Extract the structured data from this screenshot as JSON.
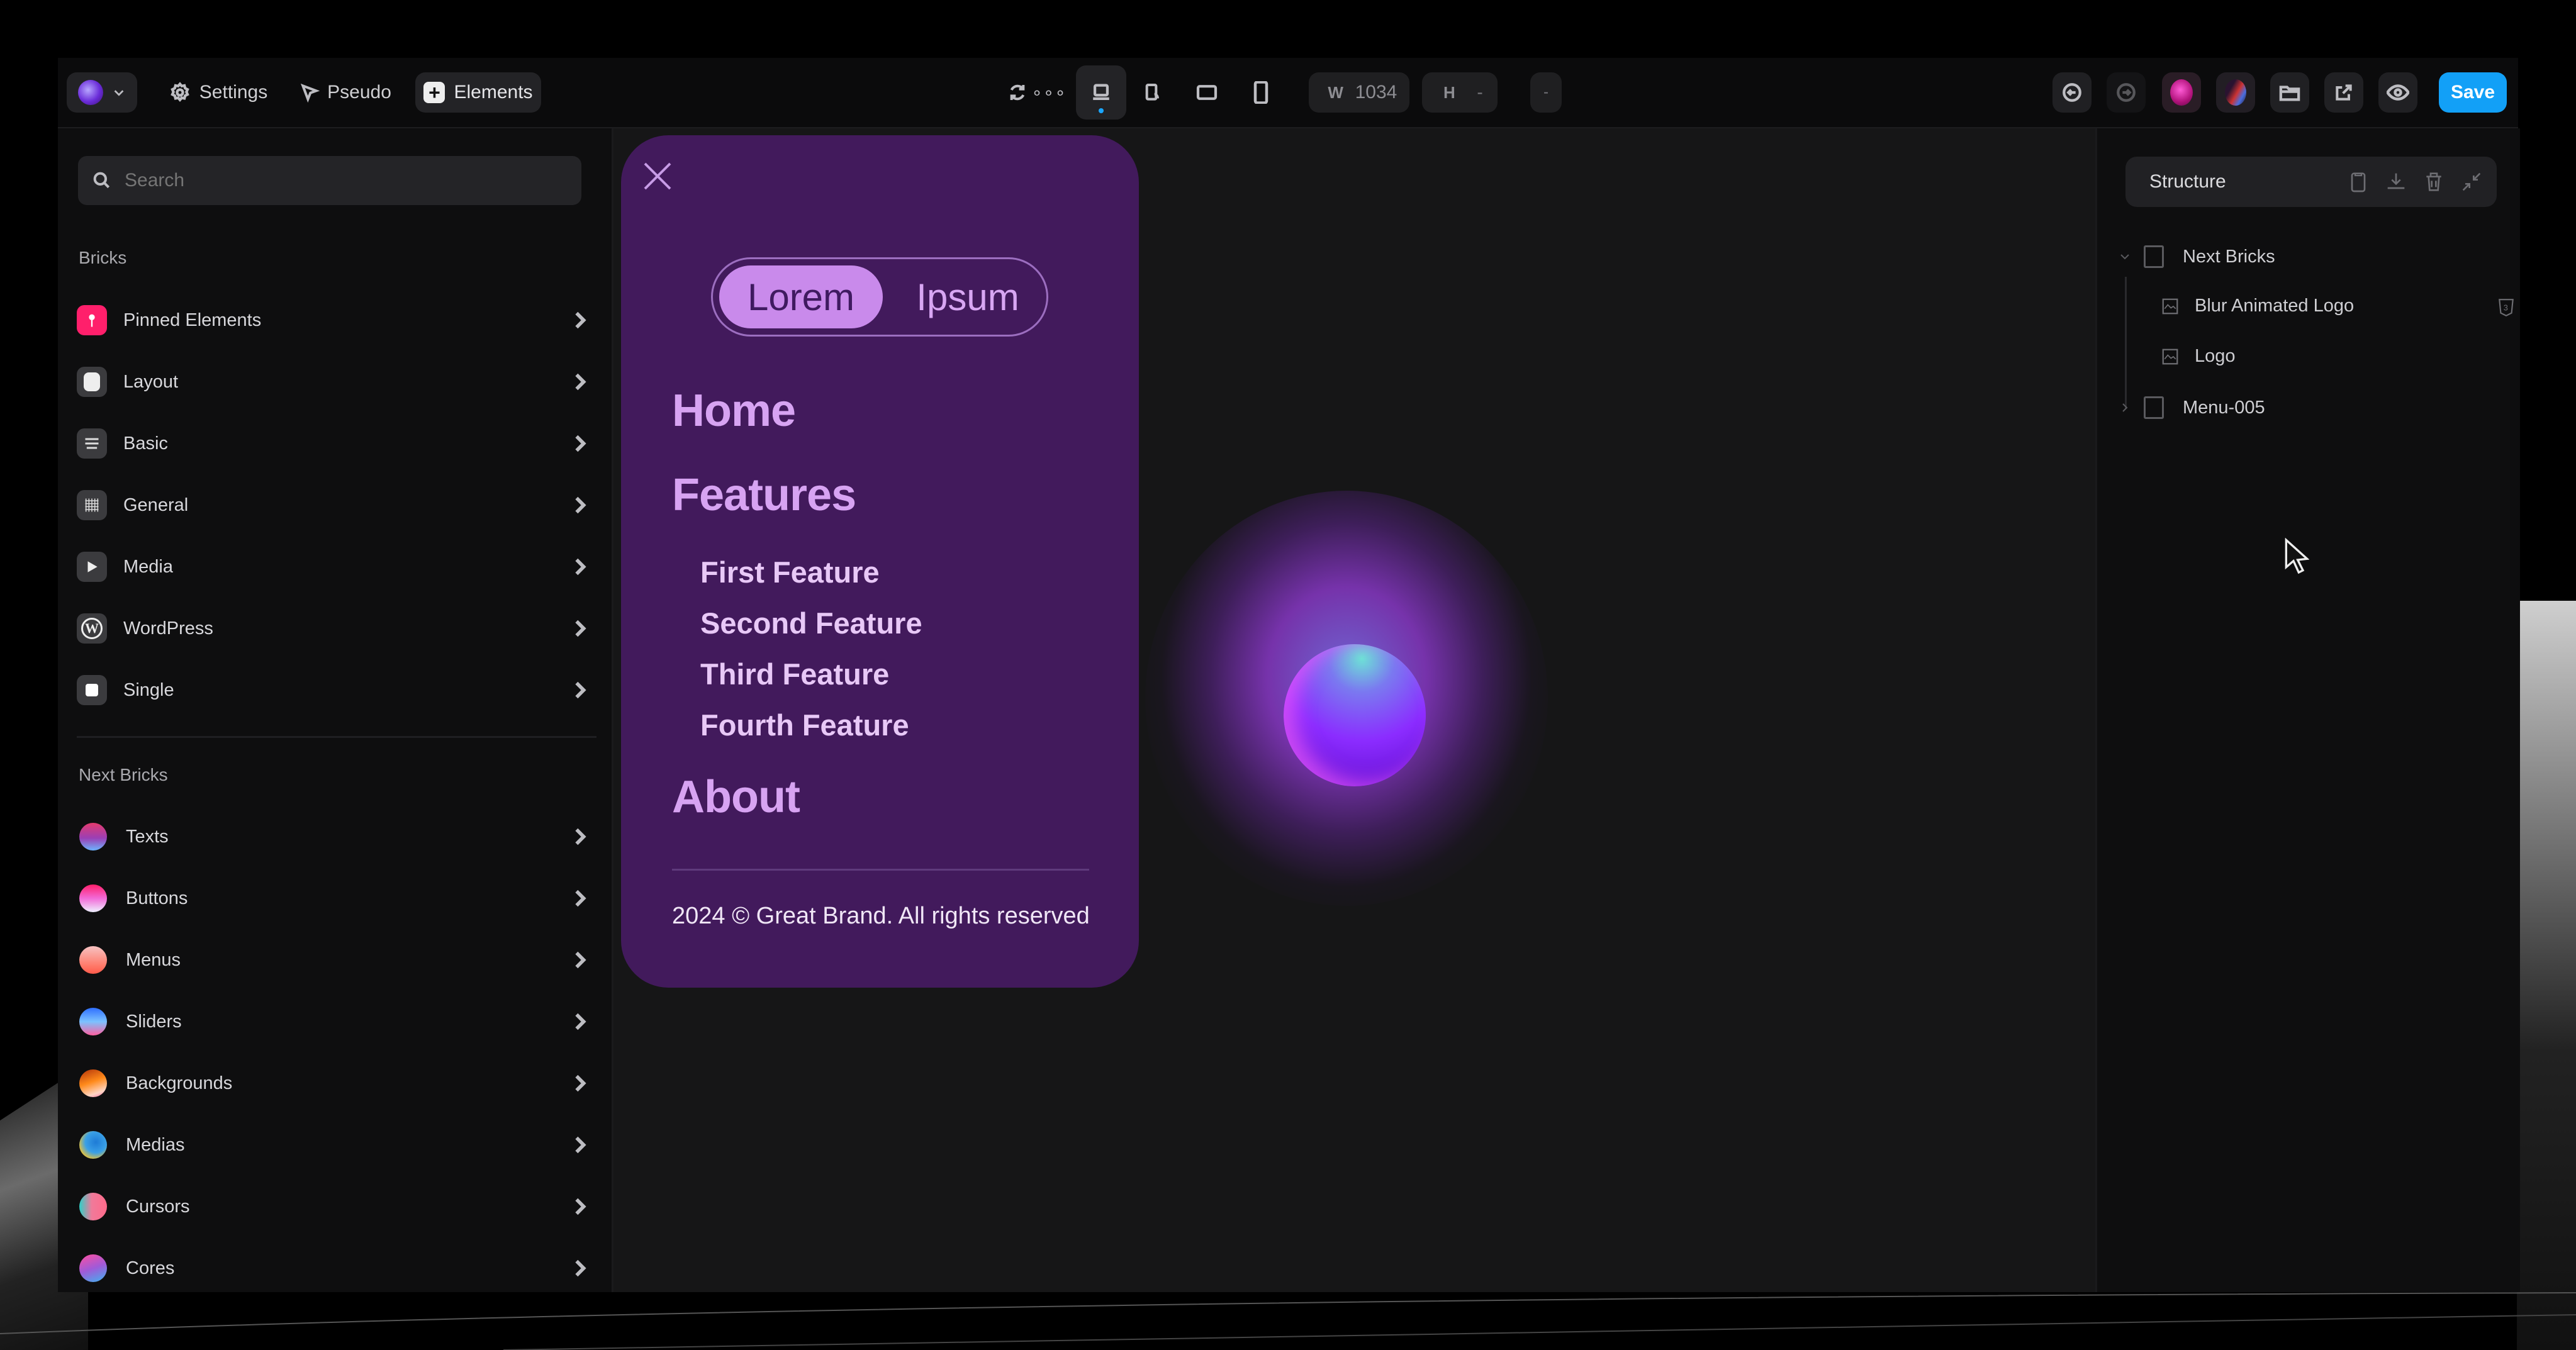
{
  "toolbar": {
    "left": {
      "settings_label": "Settings",
      "pseudo_label": "Pseudo",
      "elements_label": "Elements"
    },
    "center": {
      "width_label": "W",
      "width_value": "1034",
      "height_label": "H",
      "height_value": "-",
      "extra_value": "-",
      "active_breakpoint": "desktop"
    },
    "right": {
      "save_label": "Save",
      "save_color": "#12a0f7"
    }
  },
  "left_panel": {
    "search": {
      "placeholder": "Search",
      "value": ""
    },
    "bricks_title": "Bricks",
    "bricks_items": [
      {
        "label": "Pinned Elements",
        "icon": "pin-icon"
      },
      {
        "label": "Layout",
        "icon": "layout-icon"
      },
      {
        "label": "Basic",
        "icon": "basic-icon"
      },
      {
        "label": "General",
        "icon": "general-icon"
      },
      {
        "label": "Media",
        "icon": "play-icon"
      },
      {
        "label": "WordPress",
        "icon": "wordpress-icon"
      },
      {
        "label": "Single",
        "icon": "single-icon"
      }
    ],
    "next_bricks_title": "Next Bricks",
    "next_bricks_items": [
      {
        "label": "Texts"
      },
      {
        "label": "Buttons"
      },
      {
        "label": "Menus"
      },
      {
        "label": "Sliders"
      },
      {
        "label": "Backgrounds"
      },
      {
        "label": "Medias"
      },
      {
        "label": "Cursors"
      },
      {
        "label": "Cores"
      }
    ]
  },
  "canvas": {
    "menu": {
      "toggle_active": "Lorem",
      "toggle_inactive": "Ipsum",
      "nav": {
        "home": "Home",
        "features": "Features",
        "sub_features": [
          "First Feature",
          "Second Feature",
          "Third Feature",
          "Fourth Feature"
        ],
        "about": "About"
      },
      "footer": "2024 © Great Brand. All rights reserved",
      "background_color": "#421a5c"
    }
  },
  "right_panel": {
    "title": "Structure",
    "tree": [
      {
        "label": "Next Bricks",
        "expanded": true
      },
      {
        "label": "Blur Animated Logo",
        "child": true
      },
      {
        "label": "Logo",
        "child": true
      },
      {
        "label": "Menu-005",
        "expanded": false
      }
    ]
  }
}
